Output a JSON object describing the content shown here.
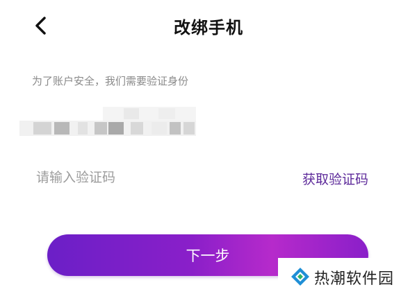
{
  "header": {
    "back_icon": "chevron-left-icon",
    "title": "改绑手机"
  },
  "form": {
    "hint": "为了账户安全，我们需要验证身份",
    "phone_masked": true,
    "code_placeholder": "请输入验证码",
    "get_code_label": "获取验证码",
    "next_label": "下一步"
  },
  "colors": {
    "accent": "#5d2a9a",
    "button_gradient_start": "#6b1fc7",
    "button_gradient_mid": "#b62acb"
  },
  "watermark": {
    "text": "热潮软件园",
    "logo_icon": "diamond-logo-icon"
  }
}
